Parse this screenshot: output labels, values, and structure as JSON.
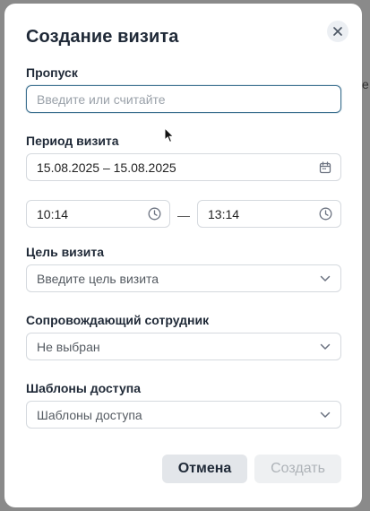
{
  "backdrop": {
    "fragment": "е"
  },
  "modal": {
    "title": "Создание визита",
    "close_icon": "close-icon"
  },
  "pass": {
    "label": "Пропуск",
    "placeholder": "Введите или считайте",
    "value": ""
  },
  "period": {
    "label": "Период визита",
    "value": "15.08.2025 – 15.08.2025",
    "icon": "calendar-icon"
  },
  "time": {
    "start": "10:14",
    "end": "13:14",
    "separator": "—",
    "icon": "clock-icon"
  },
  "purpose": {
    "label": "Цель визита",
    "placeholder": "Введите цель визита",
    "icon": "chevron-down-icon"
  },
  "escort": {
    "label": "Сопровождающий сотрудник",
    "value": "Не выбран",
    "icon": "chevron-down-icon"
  },
  "templates": {
    "label": "Шаблоны доступа",
    "placeholder": "Шаблоны доступа",
    "icon": "chevron-down-icon"
  },
  "actions": {
    "cancel": "Отмена",
    "create": "Создать"
  },
  "colors": {
    "focus_border": "#3b6f8f",
    "backdrop": "#8a8a8a"
  }
}
